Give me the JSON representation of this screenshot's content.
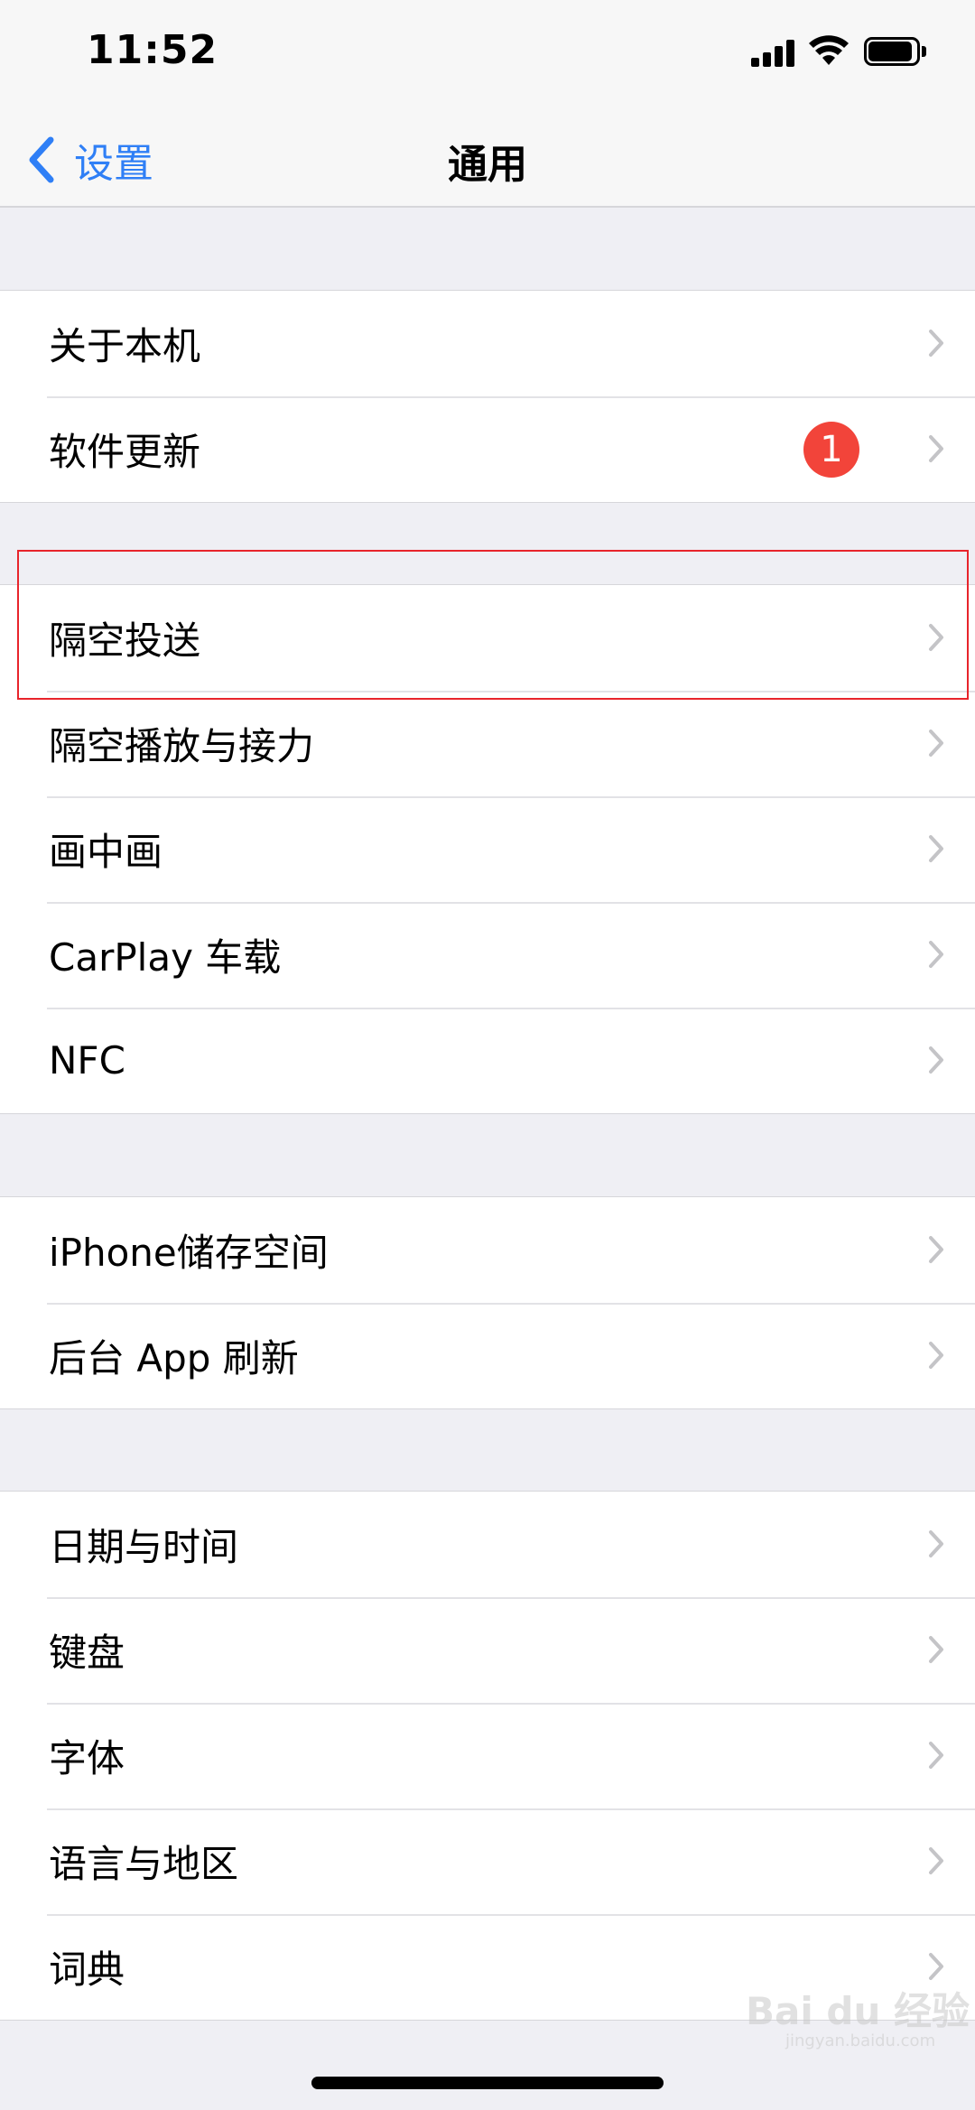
{
  "status_bar": {
    "time": "11:52"
  },
  "nav": {
    "back_label": "设置",
    "title": "通用"
  },
  "groups": [
    {
      "rows": [
        {
          "label": "关于本机"
        },
        {
          "label": "软件更新",
          "badge": "1"
        }
      ]
    },
    {
      "rows": [
        {
          "label": "隔空投送"
        },
        {
          "label": "隔空播放与接力"
        },
        {
          "label": "画中画"
        },
        {
          "label": "CarPlay 车载"
        },
        {
          "label": "NFC"
        }
      ]
    },
    {
      "rows": [
        {
          "label": "iPhone储存空间"
        },
        {
          "label": "后台 App 刷新"
        }
      ]
    },
    {
      "rows": [
        {
          "label": "日期与时间"
        },
        {
          "label": "键盘"
        },
        {
          "label": "字体"
        },
        {
          "label": "语言与地区"
        },
        {
          "label": "词典"
        }
      ]
    }
  ],
  "watermark": {
    "text": "Bai du 经验",
    "sub": "jingyan.baidu.com"
  },
  "colors": {
    "accent": "#2f7ff6",
    "badge": "#f2443a",
    "highlight": "#e8242b",
    "background": "#efeff4"
  }
}
